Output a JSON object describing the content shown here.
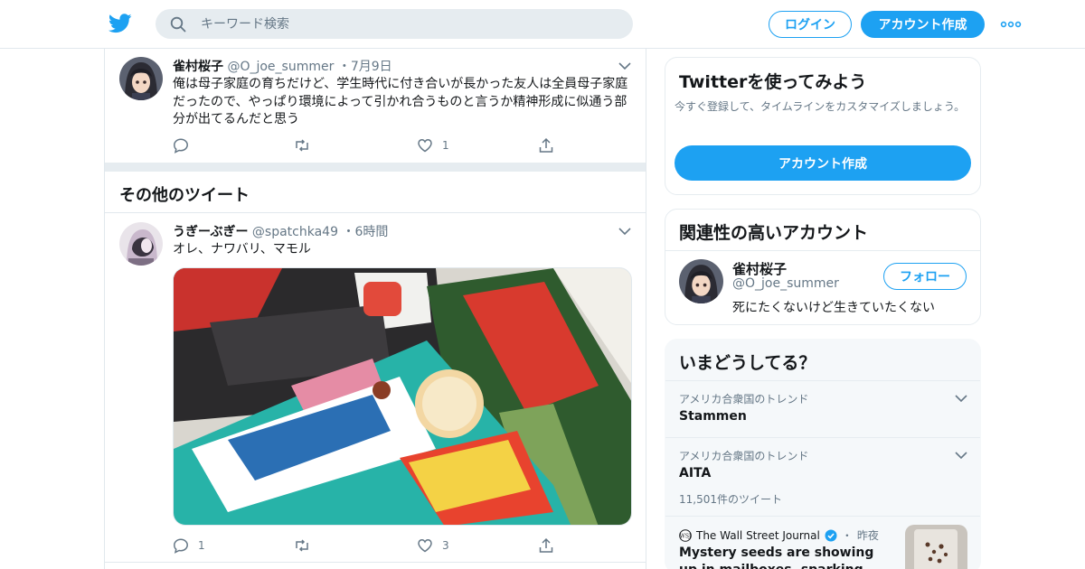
{
  "header": {
    "search_placeholder": "キーワード検索",
    "login_label": "ログイン",
    "signup_label": "アカウント作成"
  },
  "tweet1": {
    "name": "雀村桜子",
    "handle": "@O_joe_summer",
    "dot": "・",
    "time": "7月9日",
    "text": "俺は母子家庭の育ちだけど、学生時代に付き合いが長かった友人は全員母子家庭だったので、やっぱり環境によって引かれ合うものと言うか精神形成に似通う部分が出てるんだと思う",
    "reply_count": "",
    "retweet_count": "",
    "like_count": "1"
  },
  "section": {
    "title": "その他のツイート"
  },
  "tweet2": {
    "name": "うぎーぶぎー",
    "handle": "@spatchka49",
    "dot": "・",
    "time": "6時間",
    "text": "オレ、ナワバリ、マモル",
    "reply_count": "1",
    "retweet_count": "",
    "like_count": "3"
  },
  "sidebar": {
    "signup_card": {
      "title": "Twitterを使ってみよう",
      "desc": "今すぐ登録して、タイムラインをカスタマイズしましょう。",
      "button": "アカウント作成"
    },
    "related": {
      "title": "関連性の高いアカウント",
      "name": "雀村桜子",
      "handle": "@O_joe_summer",
      "bio": "死にたくないけど生きていたくない",
      "follow_label": "フォロー"
    },
    "trends": {
      "title": "いまどうしてる？",
      "items": [
        {
          "context": "アメリカ合衆国のトレンド",
          "name": "Stammen",
          "count": ""
        },
        {
          "context": "アメリカ合衆国のトレンド",
          "name": "AITA",
          "count": "11,501件のツイート"
        }
      ],
      "news": {
        "source": "The Wall Street Journal",
        "dot": "・",
        "time": "昨夜",
        "headline": "Mystery seeds are showing up in mailboxes, sparking investigations"
      }
    }
  },
  "colors": {
    "brand": "#1da1f2",
    "text": "#14171a",
    "muted": "#657786",
    "border": "#e1e8ed"
  }
}
